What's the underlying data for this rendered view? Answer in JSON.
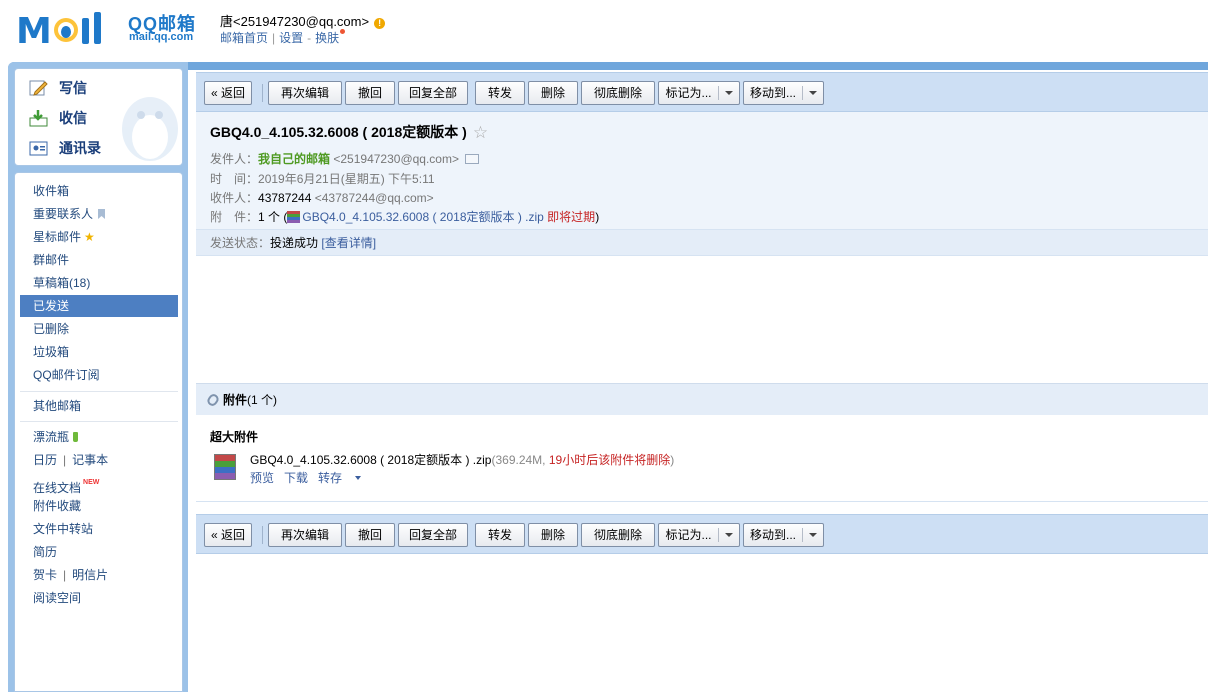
{
  "header": {
    "logo_text": "MOil",
    "brand_cn": "QQ邮箱",
    "brand_en": "mail.qq.com",
    "user": "唐<251947230@qq.com>",
    "warn_glyph": "!",
    "links": [
      "邮箱首页",
      "设置",
      "换肤"
    ]
  },
  "compose": {
    "write": "写信",
    "receive": "收信",
    "contacts": "通讯录"
  },
  "sidebar": {
    "folders": [
      "收件箱",
      "重要联系人",
      "星标邮件",
      "群邮件",
      "草稿箱(18)",
      "已发送",
      "已删除",
      "垃圾箱",
      "QQ邮件订阅"
    ],
    "other_mail": "其他邮箱",
    "drift_bottle": "漂流瓶",
    "calendar": "日历",
    "notes": "记事本",
    "online_docs": "在线文档",
    "new_badge": "NEW",
    "attach_collect": "附件收藏",
    "transfer": "文件中转站",
    "resume": "简历",
    "greeting_card": "贺卡",
    "postcard": "明信片",
    "reading": "阅读空间",
    "active_folder": "已发送"
  },
  "toolbar": {
    "back": "« 返回",
    "reedit": "再次编辑",
    "recall": "撤回",
    "reply_all": "回复全部",
    "forward": "转发",
    "delete": "删除",
    "delete_forever": "彻底删除",
    "mark_as": "标记为...",
    "move_to": "移动到..."
  },
  "mail": {
    "subject": "GBQ4.0_4.105.32.6008 ( 2018定额版本 )",
    "star": "☆",
    "from_label": "发件人：",
    "from_name": "我自己的邮箱",
    "from_addr": "<251947230@qq.com>",
    "time_label": "时　间：",
    "time_value": "2019年6月21日(星期五) 下午5:11",
    "to_label": "收件人：",
    "to_name": "43787244",
    "to_addr": "<43787244@qq.com>",
    "attach_label": "附　件：",
    "attach_count": "1 个 (",
    "attach_file": "GBQ4.0_4.105.32.6008 ( 2018定额版本 ) .zip",
    "attach_expire": "即将过期",
    "attach_close": ")",
    "status_label": "发送状态：",
    "status_value": "投递成功",
    "status_link": "[查看详情]"
  },
  "attachment": {
    "section_title": "附件",
    "section_count": "(1 个)",
    "big_title": "超大附件",
    "file_name": "GBQ4.0_4.105.32.6008 ( 2018定额版本 ) .zip",
    "file_size": "(369.24M, ",
    "file_warning": "19小时后该附件将删除",
    "file_close": ")",
    "preview": "预览",
    "download": "下载",
    "save_to": "转存"
  }
}
